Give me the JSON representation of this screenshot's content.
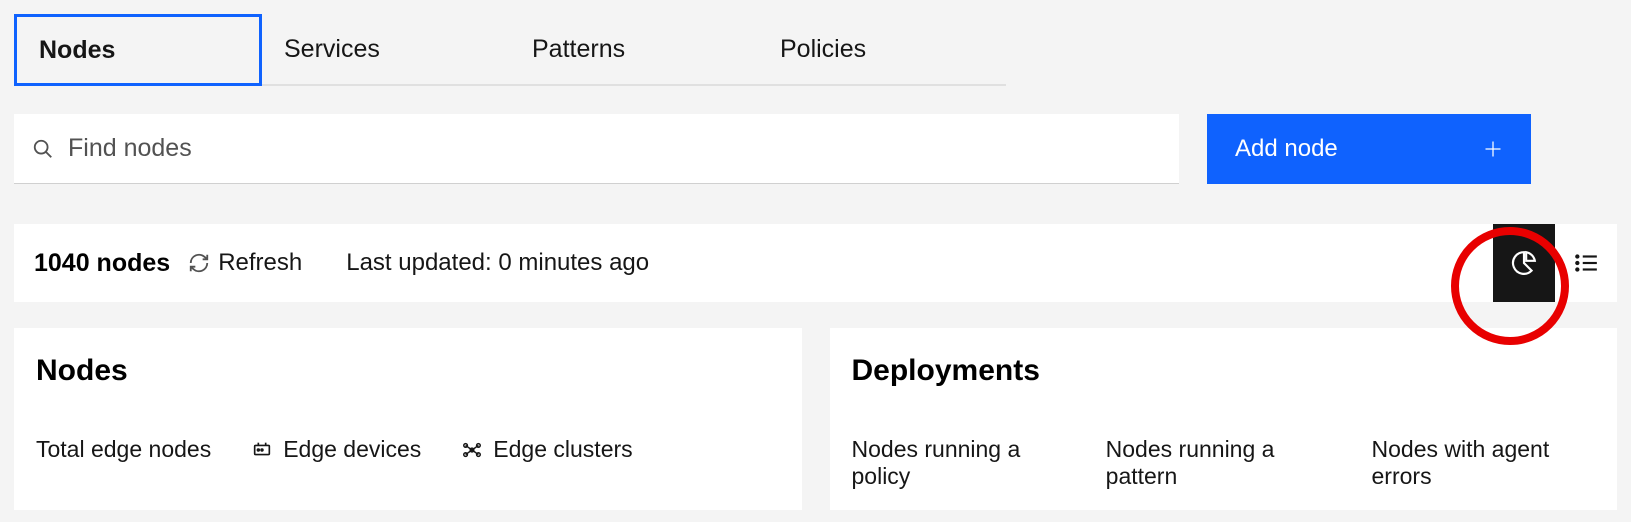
{
  "tabs": {
    "nodes": "Nodes",
    "services": "Services",
    "patterns": "Patterns",
    "policies": "Policies"
  },
  "search": {
    "placeholder": "Find nodes"
  },
  "add_button": {
    "label": "Add node"
  },
  "toolbar": {
    "count_text": "1040 nodes",
    "refresh_label": "Refresh",
    "last_updated": "Last updated: 0 minutes ago"
  },
  "cards": {
    "nodes": {
      "title": "Nodes",
      "stat1": "Total edge nodes",
      "stat2": "Edge devices",
      "stat3": "Edge clusters"
    },
    "deployments": {
      "title": "Deployments",
      "stat1": "Nodes running a policy",
      "stat2": "Nodes running a pattern",
      "stat3": "Nodes with agent errors"
    }
  }
}
